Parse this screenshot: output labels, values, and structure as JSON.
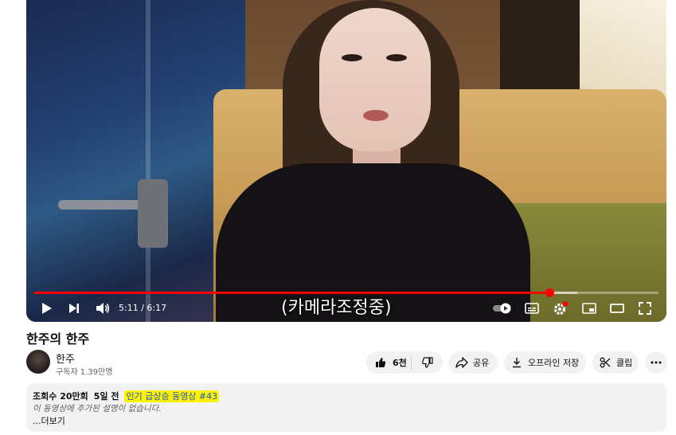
{
  "player": {
    "time_current": "5:11",
    "time_separator": " / ",
    "time_total": "6:17",
    "progress_fraction": 0.826,
    "buffered_fraction": 0.87,
    "caption": "(카메라조정중)",
    "icons": {
      "play": "play-icon",
      "next": "next-icon",
      "volume": "volume-icon",
      "autoplay": "autoplay-toggle",
      "subtitles": "subtitles-icon",
      "settings": "gear-icon",
      "miniplayer": "miniplayer-icon",
      "theater": "theater-icon",
      "fullscreen": "fullscreen-icon"
    },
    "colors": {
      "progress": "#ff0000",
      "settings_badge": "#ff0000"
    }
  },
  "video": {
    "title": "한주의 한주"
  },
  "channel": {
    "name": "한주",
    "subscribers": "구독자 1.39만명"
  },
  "actions": {
    "like_count": "6천",
    "share_label": "공유",
    "download_label": "오프라인 저장",
    "clip_label": "클립",
    "more_icon": "more-horizontal-icon"
  },
  "description": {
    "views": "조회수 20만회",
    "age": "5일 전",
    "trending_tag": "인기 급상승 동영상 #43",
    "text": "이 동영상에 추가된 설명이 없습니다.",
    "more_label": "...더보기",
    "highlight_color": "#fff200",
    "tag_color": "#1a56c9"
  }
}
